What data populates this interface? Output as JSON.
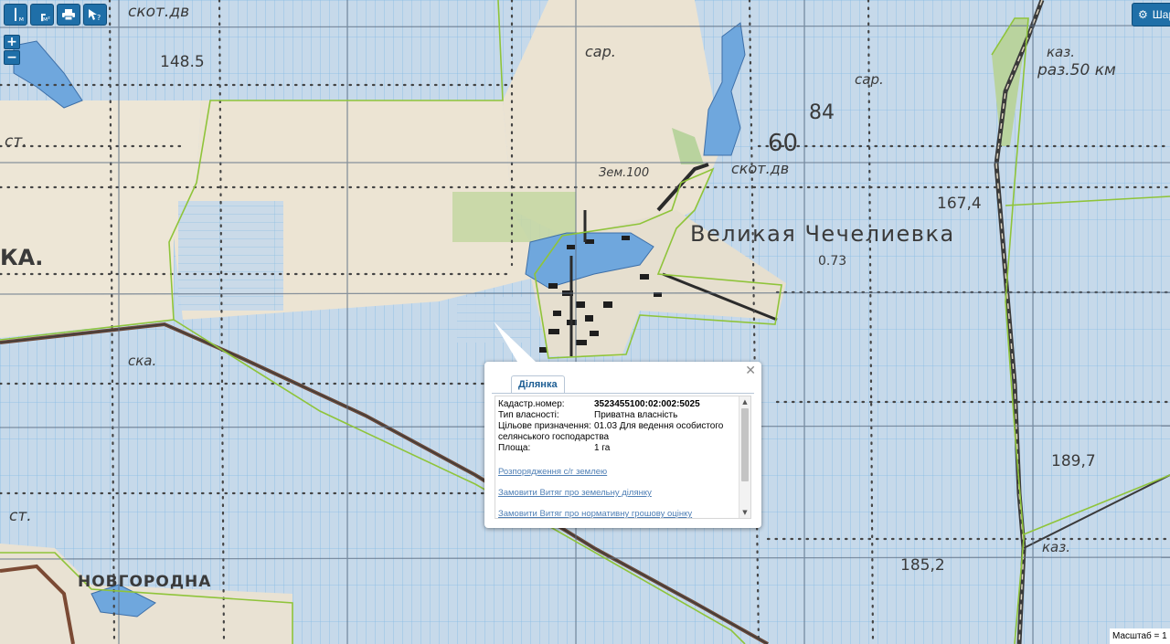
{
  "toolbar": {
    "measure_line_sub": "м",
    "measure_area_sub": "м²"
  },
  "zoom": {
    "in_label": "+",
    "out_label": "−"
  },
  "layers_button": {
    "label": "Шар"
  },
  "map_labels": {
    "l1": "скот.дв",
    "l2": "148.5",
    "l3": "сар.",
    "l4": "84",
    "l5": "60",
    "l6": "Зем.100",
    "l7": "скот.дв",
    "l8": "каз.",
    "l9": "раз.50 км",
    "l10": "сар.",
    "l11": "Великая Чечелиевка",
    "l12": "0.73",
    "l13": "167,4",
    "l14": "КА.",
    "l15": "ст.",
    "l16": "ска.",
    "l17": "ст.",
    "l18": "НОВГОРОДНА",
    "l19": "189,7",
    "l20": "185,2",
    "l21": "каз."
  },
  "popup": {
    "tab_label": "Ділянка",
    "rows": [
      {
        "label": "Кадастр.номер:",
        "value": "3523455100:02:002:5025"
      },
      {
        "label": "Тип власності:",
        "value": "Приватна власність"
      },
      {
        "label": "Цільове призначення:",
        "value": "01.03 Для ведення особистого",
        "value_cont": "селянського господарства"
      },
      {
        "label": "Площа:",
        "value": "1 га"
      }
    ],
    "links": [
      "Розпорядження с/г землею",
      "Замовити Витяг про земельну ділянку",
      "Замовити Витяг про нормативну грошову оцінку"
    ]
  },
  "scale": {
    "label": "Масштаб = 1 :"
  }
}
